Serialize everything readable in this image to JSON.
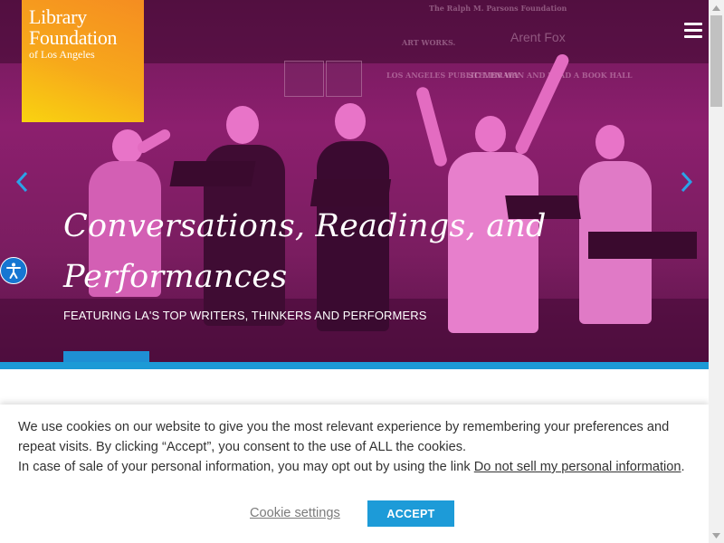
{
  "logo": {
    "line1": "Library",
    "line2": "Foundation",
    "line3": "of Los Angeles"
  },
  "hero": {
    "title": "Conversations, Readings, and Performances",
    "subtitle": "FEATURING LA'S TOP WRITERS, THINKERS AND PERFORMERS",
    "sponsors": {
      "ralph": "The Ralph M. Parsons Foundation",
      "artworks": "ART WORKS.",
      "arent_fox": "Arent Fox",
      "lapl": "LOS ANGELES PUBLIC LIBRARY",
      "reading": "STEVEN WAN AND READ A BOOK HALL"
    }
  },
  "icons": {
    "prev": "chevron-left-icon",
    "next": "chevron-right-icon",
    "menu": "hamburger-menu-icon",
    "accessibility": "accessibility-icon"
  },
  "colors": {
    "logo_orange": "#f58d21",
    "logo_yellow": "#f9d310",
    "hero_magenta": "#8c1f6e",
    "accent_blue": "#1d9bd8"
  },
  "cookie": {
    "text_part1": "We use cookies on our website to give you the most relevant experience by remembering your preferences and repeat visits. By clicking “Accept”, you consent to the use of ALL the cookies.",
    "text_part2": "In case of sale of your personal information, you may opt out by using the link ",
    "link_text": "Do not sell my personal information",
    "text_end": ".",
    "settings_label": "Cookie settings",
    "accept_label": "ACCEPT"
  }
}
